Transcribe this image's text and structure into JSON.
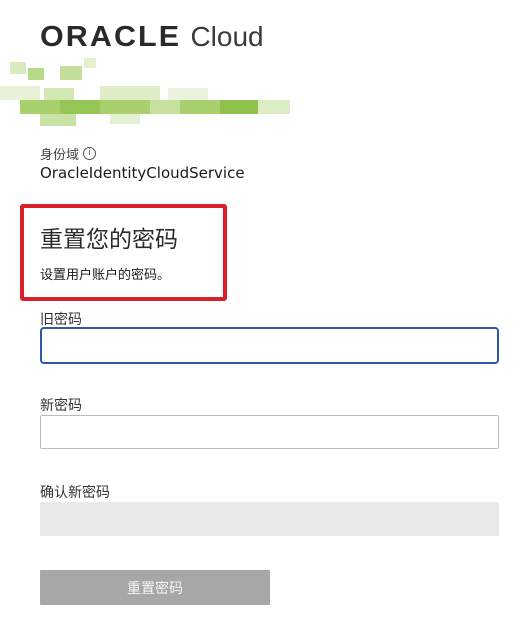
{
  "brand": {
    "wordmark": "ORACLE",
    "product": "Cloud"
  },
  "redacted_region": {
    "description_colors": [
      "#b9d98a",
      "#9ccc5e",
      "#d9ecc1"
    ]
  },
  "identity_domain": {
    "label": "身份域",
    "info_icon": "info-icon",
    "value": "OracleIdentityCloudService"
  },
  "form": {
    "title": "重置您的密码",
    "subtitle": "设置用户账户的密码。",
    "old_password": {
      "label": "旧密码",
      "value": "",
      "placeholder": ""
    },
    "new_password": {
      "label": "新密码",
      "value": "",
      "placeholder": ""
    },
    "confirm_password": {
      "label": "确认新密码",
      "value": "",
      "placeholder": ""
    },
    "submit_label": "重置密码"
  },
  "colors": {
    "highlight": "#d81f2a",
    "focus": "#2c5aa8",
    "button_disabled": "#a7a7a7"
  }
}
